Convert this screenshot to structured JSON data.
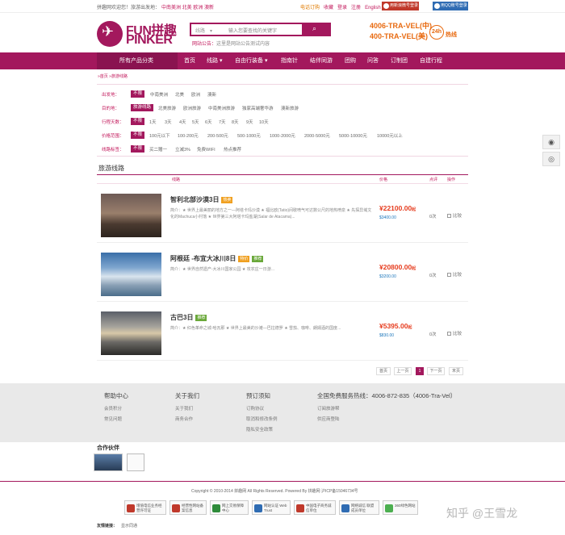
{
  "topbar": {
    "welcome": "拼趣网欢迎您！旅游出发地：",
    "hot_destinations": "中南美洲 北美 欧洲 澳新",
    "phone_link": "电话订购",
    "bookmark": "收藏",
    "login": "登录",
    "register": "注册",
    "english": "English",
    "weibo_login": "用新浪微号登录",
    "qq_login": "用QQ账号登录"
  },
  "header": {
    "logo_top": "FUN拼趣",
    "logo_bottom": "PINKER",
    "search_category": "线路",
    "search_placeholder": "输入您要查找的关键字",
    "notice_label": "网站公告：",
    "notice_text": "这里是网站公告测试内容",
    "hotline_1": "4006-TRA-VEL(中)",
    "hotline_2": "400-TRA-VEL(美)",
    "h24": "24h",
    "h24_label": "热线"
  },
  "nav": {
    "all_categories": "所有产品分类",
    "items": [
      "首页",
      "线路",
      "自由行装备",
      "指南针",
      "结伴同游",
      "团购",
      "问答",
      "订制团",
      "自建行程"
    ]
  },
  "breadcrumb": "»首页 »旅游线路",
  "filters": [
    {
      "label": "出发地：",
      "selected": "不限",
      "options": [
        "中南美洲",
        "北美",
        "欧洲",
        "澳新"
      ]
    },
    {
      "label": "目的地：",
      "selected": "旅游线路",
      "options": [
        "北美旅游",
        "欧洲旅游",
        "中南美洲旅游",
        "独家高端奢华游",
        "澳新旅游"
      ]
    },
    {
      "label": "行程天数：",
      "selected": "不限",
      "options": [
        "1天",
        "3天",
        "4天",
        "5天",
        "6天",
        "7天",
        "8天",
        "9天",
        "10天"
      ]
    },
    {
      "label": "价格范围：",
      "selected": "不限",
      "options": [
        "100元以下",
        "100-200元",
        "200-500元",
        "500-1000元",
        "1000-2000元",
        "2000-5000元",
        "5000-10000元",
        "10000元以上"
      ]
    },
    {
      "label": "线路标签：",
      "selected": "不限",
      "options": [
        "买二赠一",
        "立减3%",
        "免费WIFI",
        "热点推荐"
      ]
    }
  ],
  "list": {
    "title": "旅游线路",
    "headers": {
      "route": "线路",
      "price": "价格",
      "reviews": "点评",
      "action": "操作"
    },
    "trips": [
      {
        "name": "智利北部沙漠3日",
        "tags": [
          {
            "text": "热卖",
            "color": "#f0a020"
          }
        ],
        "desc": "简介：★ 世界上最美丽的地方之一—阿塔卡玛沙漠 ★ 福比欧(Tatio)间歇喷气可达数公尺的地热喷泉 ★ 先探异域文化的Machuca小村落 ★ 世界第三大阿塔卡玛盐湖(Salar de Atacama)...",
        "price": "¥22100.00",
        "price_suffix": "起",
        "orig": "$3400.00",
        "count": "0次",
        "compare": "比较"
      },
      {
        "name": "阿根廷 -布宜大冰川8日",
        "tags": [
          {
            "text": "特价",
            "color": "#f0a020"
          },
          {
            "text": "推荐",
            "color": "#6aa83a"
          }
        ],
        "desc": "简介：★ 世界自然遗产-大冰川国家公园 ★ 攻农庄一日游...",
        "price": "¥20800.00",
        "price_suffix": "起",
        "orig": "$3200.00",
        "count": "0次",
        "compare": "比较"
      },
      {
        "name": "古巴3日",
        "tags": [
          {
            "text": "推荐",
            "color": "#6aa83a"
          }
        ],
        "desc": "简介：★ 红色革命之城-哈瓦那 ★ 世界上最美的沙滩—巴拉德罗 ★ 雪茄、咖啡、朗姆酒的国度...",
        "price": "¥5395.00",
        "price_suffix": "起",
        "orig": "$830.00",
        "count": "0次",
        "compare": "比较"
      }
    ]
  },
  "pager": {
    "first": "首页",
    "prev": "上一页",
    "current": "1",
    "next": "下一页",
    "last": "末页"
  },
  "footer": {
    "columns": [
      {
        "title": "帮助中心",
        "links": [
          "会员积分",
          "常见问题"
        ]
      },
      {
        "title": "关于我们",
        "links": [
          "关于我们",
          "商务合作"
        ]
      },
      {
        "title": "预订须知",
        "links": [
          "订购协议",
          "取消和修改条例",
          "隐私安全政策"
        ]
      },
      {
        "title": "全国免费服务热线：4006-872-835（4006-Tra-Vel）",
        "links": [
          "订阅旅游帮",
          "供应商登陆"
        ]
      }
    ],
    "partners_title": "合作伙伴",
    "copyright": "Copyright © 2010-2014 拼趣网 All Rights Reserved. Powered By 拼趣网  沪ICP备15046734号",
    "badges": [
      {
        "text": "增值电信业务经营许可证",
        "color": "#c0392b"
      },
      {
        "text": "经营性网站备案信息",
        "color": "#c0392b"
      },
      {
        "text": "网上交易保障中心",
        "color": "#2e8b3a"
      },
      {
        "text": "网站认证 Web Trust",
        "color": "#2f6cb3"
      },
      {
        "text": "中国电子商务诚信单位",
        "color": "#c0392b"
      },
      {
        "text": "网络诚信 联盟成员单位",
        "color": "#2f6cb3"
      },
      {
        "text": "360绿色网站",
        "color": "#4caf50"
      }
    ],
    "friend_label": "友情链接：",
    "friend_link": "显示同通"
  },
  "watermark": "知乎 @王雪龙"
}
